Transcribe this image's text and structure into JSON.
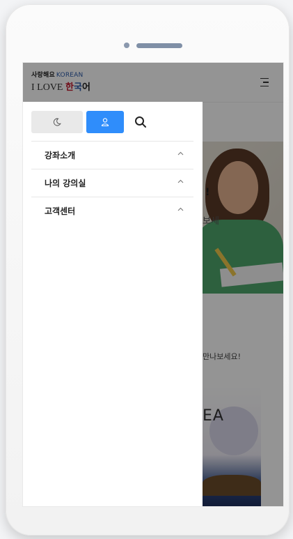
{
  "logo": {
    "line1_korean": "사랑해요",
    "line1_english": "KOREAN",
    "line2_english": "I LOVE",
    "line2_han": "한",
    "line2_guk": "국",
    "line2_eo": "어"
  },
  "hero": {
    "headline_fragment": "!",
    "subline_fragment": "보세"
  },
  "section": {
    "text_fragment": "만나보세요!"
  },
  "card": {
    "text_fragment": "EA"
  },
  "drawer": {
    "icons": {
      "theme": "moon-icon",
      "user": "user-icon",
      "search": "search-icon"
    },
    "menu": [
      {
        "label": "강좌소개"
      },
      {
        "label": "나의 강의실"
      },
      {
        "label": "고객센터"
      }
    ]
  },
  "colors": {
    "accent_blue": "#2f8dfb",
    "logo_red": "#c2182b",
    "logo_blue": "#2b5aa8"
  }
}
